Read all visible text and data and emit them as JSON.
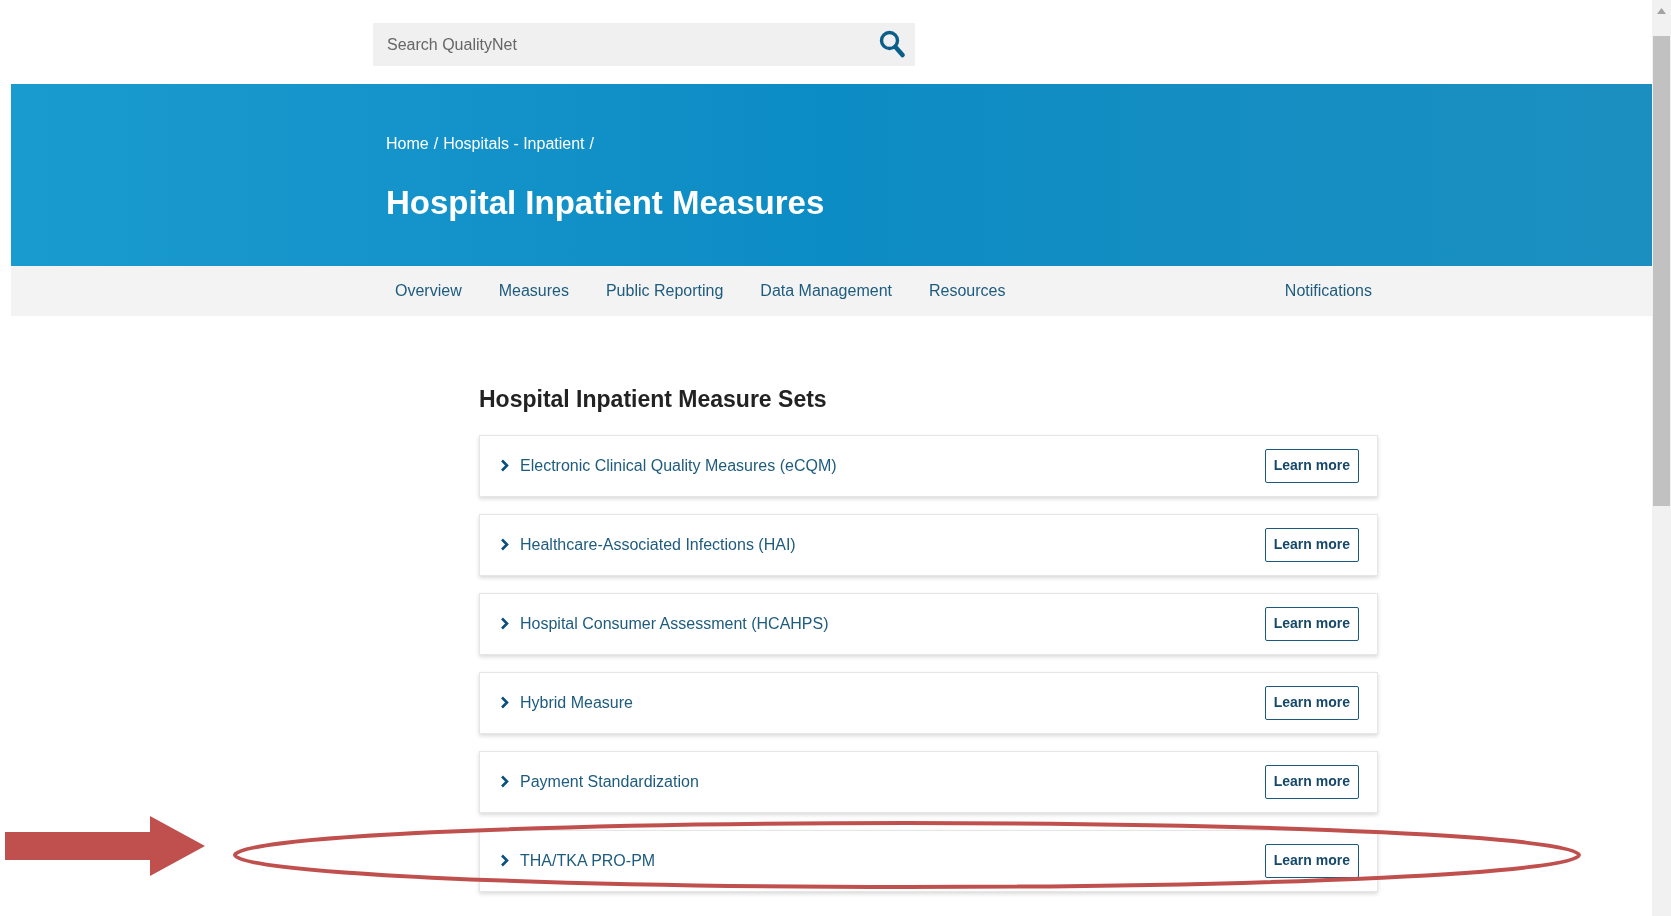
{
  "search": {
    "placeholder": "Search QualityNet"
  },
  "breadcrumb": [
    {
      "label": "Home",
      "separator": "/"
    },
    {
      "label": "Hospitals - Inpatient",
      "separator": "/"
    }
  ],
  "page_title": "Hospital Inpatient Measures",
  "nav": {
    "items": [
      "Overview",
      "Measures",
      "Public Reporting",
      "Data Management",
      "Resources"
    ],
    "right_item": "Notifications"
  },
  "section": {
    "title": "Hospital Inpatient Measure Sets",
    "items": [
      {
        "label": "Electronic Clinical Quality Measures (eCQM)",
        "button": "Learn more",
        "highlighted": false
      },
      {
        "label": "Healthcare-Associated Infections (HAI)",
        "button": "Learn more",
        "highlighted": false
      },
      {
        "label": "Hospital Consumer Assessment (HCAHPS)",
        "button": "Learn more",
        "highlighted": false
      },
      {
        "label": "Hybrid Measure",
        "button": "Learn more",
        "highlighted": false
      },
      {
        "label": "Payment Standardization",
        "button": "Learn more",
        "highlighted": false
      },
      {
        "label": "THA/TKA PRO-PM",
        "button": "Learn more",
        "highlighted": true
      }
    ]
  }
}
